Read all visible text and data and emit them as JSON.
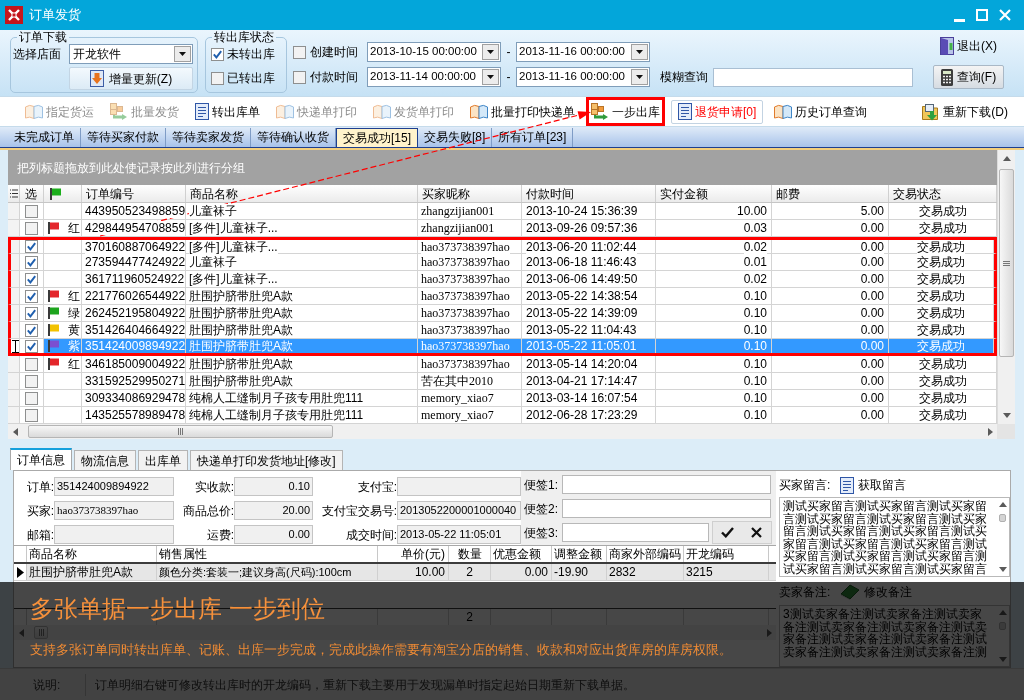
{
  "window": {
    "title": "订单发货"
  },
  "filters": {
    "download_group": {
      "legend": "订单下载",
      "store_label": "选择店面",
      "store": "开龙软件",
      "update_button": "增量更新(Z)"
    },
    "status_group": {
      "legend": "转出库状态",
      "options": [
        {
          "label": "未转出库",
          "checked": true
        },
        {
          "label": "已转出库",
          "checked": false
        }
      ]
    },
    "date_ranges": [
      {
        "label": "创建时间",
        "checked": false,
        "from": "2013-10-15 00:00:00",
        "separator": "-",
        "to": "2013-11-16 00:00:00"
      },
      {
        "label": "付款时间",
        "checked": false,
        "from": "2013-11-14 00:00:00",
        "separator": "-",
        "to": "2013-11-16 00:00:00"
      }
    ],
    "fuzzy_search": {
      "label": "模糊查询"
    },
    "exit_button": "退出(X)",
    "query_button": "查询(F)"
  },
  "toolbar": {
    "items": [
      {
        "label": "指定货运",
        "disabled": true,
        "highlighted": false,
        "alert": false
      },
      {
        "label": "批量发货",
        "disabled": true,
        "highlighted": false,
        "alert": false
      },
      {
        "label": "转出库单",
        "disabled": false,
        "highlighted": false,
        "alert": false
      },
      {
        "label": "快递单打印",
        "disabled": true,
        "highlighted": false,
        "alert": false
      },
      {
        "label": "发货单打印",
        "disabled": true,
        "highlighted": false,
        "alert": false
      },
      {
        "label": "批量打印快递单",
        "disabled": false,
        "highlighted": false,
        "alert": false
      },
      {
        "label": "一步出库",
        "disabled": false,
        "highlighted": true,
        "alert": false
      },
      {
        "label": "退货申请[0]",
        "disabled": false,
        "highlighted": false,
        "alert": true
      },
      {
        "label": "历史订单查询",
        "disabled": false,
        "highlighted": false,
        "alert": false
      }
    ],
    "reload_button": "重新下载(D)"
  },
  "tabs": [
    {
      "label": "未完成订单",
      "selected": false
    },
    {
      "label": "等待买家付款",
      "selected": false
    },
    {
      "label": "等待卖家发货",
      "selected": false
    },
    {
      "label": "等待确认收货",
      "selected": false
    },
    {
      "label": "交易成功[15]",
      "selected": true
    },
    {
      "label": "交易失败[8]",
      "selected": false
    },
    {
      "label": "所有订单[23]",
      "selected": false
    }
  ],
  "order_grid": {
    "group_hint": "把列标题拖放到此处使记录按此列进行分组",
    "columns": [
      "选",
      "订单编号",
      "商品名称",
      "买家昵称",
      "付款时间",
      "实付金额",
      "邮费",
      "交易状态"
    ],
    "rows": [
      {
        "checked": false,
        "order_no": "443950523498859",
        "product": "儿童袜子",
        "buyer": "zhangzijian001",
        "paid_at": "2013-10-24 15:36:39",
        "amount": "10.00",
        "postage": "5.00",
        "status": "交易成功",
        "selected": false,
        "highlighted": false
      },
      {
        "checked": false,
        "flag": {
          "label": "红",
          "color": "#e3262b"
        },
        "order_no": "429844954708859",
        "product": "[多件]儿童袜子...",
        "buyer": "zhangzijian001",
        "paid_at": "2013-09-26 09:57:36",
        "amount": "0.03",
        "postage": "0.00",
        "status": "交易成功",
        "selected": false,
        "highlighted": false
      },
      {
        "checked": true,
        "order_no": "370160887064922",
        "product": "[多件]儿童袜子...",
        "buyer": "hao373738397hao",
        "paid_at": "2013-06-20 11:02:44",
        "amount": "0.02",
        "postage": "0.00",
        "status": "交易成功",
        "selected": false,
        "highlighted": true
      },
      {
        "checked": true,
        "order_no": "273594477424922",
        "product": "儿童袜子",
        "buyer": "hao373738397hao",
        "paid_at": "2013-06-18 11:46:43",
        "amount": "0.01",
        "postage": "0.00",
        "status": "交易成功",
        "selected": false,
        "highlighted": true
      },
      {
        "checked": true,
        "order_no": "361711960524922",
        "product": "[多件]儿童袜子...",
        "buyer": "hao373738397hao",
        "paid_at": "2013-06-06 14:49:50",
        "amount": "0.02",
        "postage": "0.00",
        "status": "交易成功",
        "selected": false,
        "highlighted": true
      },
      {
        "checked": true,
        "flag": {
          "label": "红",
          "color": "#e3262b"
        },
        "order_no": "221776026544922",
        "product": "肚围护脐带肚兜A款",
        "buyer": "hao373738397hao",
        "paid_at": "2013-05-22 14:38:54",
        "amount": "0.10",
        "postage": "0.00",
        "status": "交易成功",
        "selected": false,
        "highlighted": true
      },
      {
        "checked": true,
        "flag": {
          "label": "绿",
          "color": "#1ea51e"
        },
        "order_no": "262452195804922",
        "product": "肚围护脐带肚兜A款",
        "buyer": "hao373738397hao",
        "paid_at": "2013-05-22 14:39:09",
        "amount": "0.10",
        "postage": "0.00",
        "status": "交易成功",
        "selected": false,
        "highlighted": true
      },
      {
        "checked": true,
        "flag": {
          "label": "黄",
          "color": "#f2c200"
        },
        "order_no": "351426404664922",
        "product": "肚围护脐带肚兜A款",
        "buyer": "hao373738397hao",
        "paid_at": "2013-05-22 11:04:43",
        "amount": "0.10",
        "postage": "0.00",
        "status": "交易成功",
        "selected": false,
        "highlighted": true
      },
      {
        "checked": true,
        "flag": {
          "label": "紫",
          "color": "#7b4fd0"
        },
        "order_no": "351424009894922",
        "product": "肚围护脐带肚兜A款",
        "buyer": "hao373738397hao",
        "paid_at": "2013-05-22 11:05:01",
        "amount": "0.10",
        "postage": "0.00",
        "status": "交易成功",
        "selected": true,
        "highlighted": true
      },
      {
        "checked": false,
        "flag": {
          "label": "红",
          "color": "#e3262b"
        },
        "order_no": "346185009004922",
        "product": "肚围护脐带肚兜A款",
        "buyer": "hao373738397hao",
        "paid_at": "2013-05-14 14:20:04",
        "amount": "0.10",
        "postage": "0.00",
        "status": "交易成功",
        "selected": false,
        "highlighted": false
      },
      {
        "checked": false,
        "order_no": "331592529950271",
        "product": "肚围护脐带肚兜A款",
        "buyer": "苦在其中2010",
        "paid_at": "2013-04-21 17:14:47",
        "amount": "0.10",
        "postage": "0.00",
        "status": "交易成功",
        "selected": false,
        "highlighted": false
      },
      {
        "checked": false,
        "order_no": "309334086929478",
        "product": "纯棉人工缝制月子孩专用肚兜111",
        "buyer": "memory_xiao7",
        "paid_at": "2013-03-14 16:07:54",
        "amount": "0.10",
        "postage": "0.00",
        "status": "交易成功",
        "selected": false,
        "highlighted": false
      },
      {
        "checked": false,
        "order_no": "143525578989478",
        "product": "纯棉人工缝制月子孩专用肚兜111",
        "buyer": "memory_xiao7",
        "paid_at": "2012-06-28 17:23:29",
        "amount": "0.10",
        "postage": "0.00",
        "status": "交易成功",
        "selected": false,
        "highlighted": false
      }
    ]
  },
  "detail_tabs": [
    {
      "label": "订单信息",
      "selected": true
    },
    {
      "label": "物流信息",
      "selected": false
    },
    {
      "label": "出库单",
      "selected": false
    },
    {
      "label": "快递单打印发货地址[修改]",
      "selected": false
    }
  ],
  "order_info": {
    "fields": [
      {
        "label": "订单:",
        "value": "351424009894922",
        "kind": "text"
      },
      {
        "label": "实收款:",
        "value": "0.10",
        "kind": "amount"
      },
      {
        "label": "支付宝:",
        "kind": "text"
      },
      {
        "label": "买家:",
        "value": "hao373738397hao",
        "kind": "text"
      },
      {
        "label": "商品总价:",
        "value": "20.00",
        "kind": "amount"
      },
      {
        "label": "支付宝交易号:",
        "value": "2013052200001000040",
        "kind": "text"
      },
      {
        "label": "邮箱:",
        "kind": "text"
      },
      {
        "label": "运费:",
        "value": "0.00",
        "kind": "amount"
      },
      {
        "label": "成交时间:",
        "value": "2013-05-22 11:05:01",
        "kind": "text"
      }
    ]
  },
  "notes": [
    {
      "label": "便签1:"
    },
    {
      "label": "便签2:"
    },
    {
      "label": "便签3:"
    }
  ],
  "items_grid": {
    "columns": [
      "商品名称",
      "销售属性",
      "单价(元)",
      "数量",
      "优惠金额",
      "调整金额",
      "商家外部编码",
      "开龙编码"
    ],
    "rows": [
      {
        "cells": [
          "肚围护脐带肚兜A款",
          "颜色分类:套装一;建议身高(尺码):100cm",
          "10.00",
          "2",
          "0.00",
          "-19.90",
          "2832",
          "3215"
        ],
        "selected": true
      }
    ],
    "totals": {
      "quantity": "2"
    }
  },
  "buyer_message": {
    "label": "买家留言:",
    "button": "获取留言",
    "text": "测试买家留言测试买家留言测试买家留言测试买家留言测试买家留言测试买家留言测试买家留言测试买家留言测试买家留言测试买家留言测试买家留言测试买家留言测试买家留言测试买家留言测试买家留言测试买家留言测试买家留言"
  },
  "seller_note": {
    "label": "卖家备注:",
    "button": "修改备注",
    "text": "3测试卖家备注测试卖家备注测试卖家备注测试卖家备注测试卖家备注测试卖家备注测试卖家备注测试卖家备注测试卖家备注测试卖家备注测试卖家备注测"
  },
  "status_bar": {
    "label": "说明:",
    "text": "订单明细右键可修改转出库时的开龙编码，重新下载主要用于发现漏单时指定起始日期重新下载单据。"
  },
  "promo_banner": {
    "headline": "多张单据一步出库 一步到位",
    "description": "支持多张订单同时转出库单、记账、出库一步完成，完成此操作需要有淘宝分店的销售、收款和对应出货库房的库房权限。"
  }
}
